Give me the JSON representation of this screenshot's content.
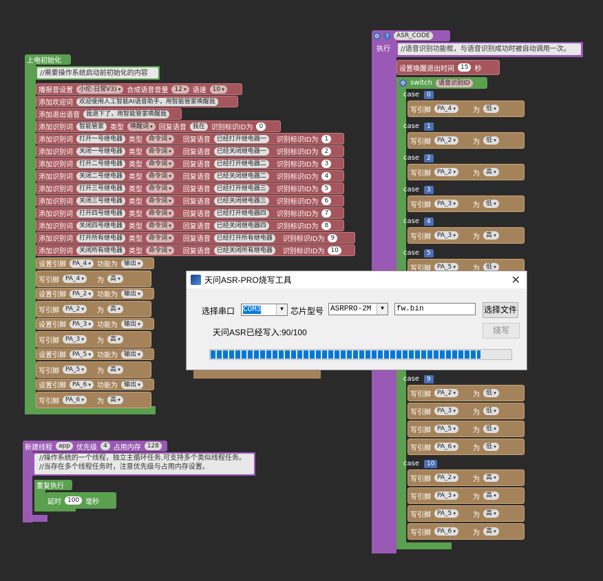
{
  "init": {
    "header": "上电初始化",
    "comment": "//需要操作系统启动前初始化的内容",
    "broadcast": {
      "label": "播报音设置",
      "voice": "小伦-日常V3)",
      "vol_label": "合成语音音量",
      "vol": "12",
      "speed_label": "语速",
      "speed": "10"
    },
    "welcome": {
      "label": "添加欢迎词",
      "text": "欢迎使用人工智能AI语音助手，用智能管家唤醒我"
    },
    "exit": {
      "label": "添加退出语音",
      "text": "我退下了，用智能管家唤醒我"
    },
    "wake": {
      "label": "添加识别词",
      "word": "智能管家",
      "type_label": "类型",
      "type": "唤醒词",
      "reply_label": "回复语音",
      "reply": "我在",
      "id_label": "识别标识ID为",
      "id": "0"
    },
    "cmds": [
      {
        "label": "添加识别词",
        "word": "打开一号继电器",
        "type_label": "类型",
        "type": "命令词",
        "reply_label": "回复语音",
        "reply": "已经打开继电器一",
        "id_label": "识别标识ID为",
        "id": "1"
      },
      {
        "label": "添加识别词",
        "word": "关闭一号继电器",
        "type_label": "类型",
        "type": "命令词",
        "reply_label": "回复语音",
        "reply": "已经关闭继电器一",
        "id_label": "识别标识ID为",
        "id": "2"
      },
      {
        "label": "添加识别词",
        "word": "打开二号继电器",
        "type_label": "类型",
        "type": "命令词",
        "reply_label": "回复语音",
        "reply": "已经打开继电器二",
        "id_label": "识别标识ID为",
        "id": "3"
      },
      {
        "label": "添加识别词",
        "word": "关闭二号继电器",
        "type_label": "类型",
        "type": "命令词",
        "reply_label": "回复语音",
        "reply": "已经关闭继电器二",
        "id_label": "识别标识ID为",
        "id": "4"
      },
      {
        "label": "添加识别词",
        "word": "打开三号继电器",
        "type_label": "类型",
        "type": "命令词",
        "reply_label": "回复语音",
        "reply": "已经打开继电器三",
        "id_label": "识别标识ID为",
        "id": "5"
      },
      {
        "label": "添加识别词",
        "word": "关闭三号继电器",
        "type_label": "类型",
        "type": "命令词",
        "reply_label": "回复语音",
        "reply": "已经关闭继电器三",
        "id_label": "识别标识ID为",
        "id": "6"
      },
      {
        "label": "添加识别词",
        "word": "打开四号继电器",
        "type_label": "类型",
        "type": "命令词",
        "reply_label": "回复语音",
        "reply": "已经打开继电器四",
        "id_label": "识别标识ID为",
        "id": "7"
      },
      {
        "label": "添加识别词",
        "word": "关闭四号继电器",
        "type_label": "类型",
        "type": "命令词",
        "reply_label": "回复语音",
        "reply": "已经关闭继电器四",
        "id_label": "识别标识ID为",
        "id": "8"
      },
      {
        "label": "添加识别词",
        "word": "打开所有继电器",
        "type_label": "类型",
        "type": "命令词",
        "reply_label": "回复语音",
        "reply": "已经打开所有继电器",
        "id_label": "识别标识ID为",
        "id": "9"
      },
      {
        "label": "添加识别词",
        "word": "关闭所有继电器",
        "type_label": "类型",
        "type": "命令词",
        "reply_label": "回复语音",
        "reply": "已经关闭所有继电器",
        "id_label": "识别标识ID为",
        "id": "10"
      }
    ],
    "pins": [
      {
        "set_label": "设置引脚",
        "pin": "PA_4",
        "func_label": "功能为",
        "func": "输出",
        "write_label": "写引脚",
        "as": "为",
        "val": "高"
      },
      {
        "set_label": "设置引脚",
        "pin": "PA_2",
        "func_label": "功能为",
        "func": "输出",
        "write_label": "写引脚",
        "as": "为",
        "val": "高"
      },
      {
        "set_label": "设置引脚",
        "pin": "PA_3",
        "func_label": "功能为",
        "func": "输出",
        "write_label": "写引脚",
        "as": "为",
        "val": "高"
      },
      {
        "set_label": "设置引脚",
        "pin": "PA_5",
        "func_label": "功能为",
        "func": "输出",
        "write_label": "写引脚",
        "as": "为",
        "val": "高"
      },
      {
        "set_label": "设置引脚",
        "pin": "PA_6",
        "func_label": "功能为",
        "func": "输出",
        "write_label": "写引脚",
        "as": "为",
        "val": "高"
      }
    ]
  },
  "thread": {
    "label": "新建线程",
    "name": "app",
    "prio_label": "优先级",
    "prio": "4",
    "mem_label": "占用内存",
    "mem": "128",
    "comment1": "//操作系统的一个线程，独立主循环任务,可支持多个类似线程任务。",
    "comment2": "//当存在多个线程任务时，注意优先级与占用内存设置。",
    "loop": "重复执行",
    "delay_label": "延时",
    "delay": "100",
    "delay_unit": "毫秒"
  },
  "asr": {
    "title": "ASR_CODE",
    "exec": "执行",
    "comment": "//语音识别功能框，与语音识别成功时被自动调用一次。",
    "timeout_label": "设置唤醒退出时间",
    "timeout": "15",
    "timeout_unit": "秒",
    "switch_label": "switch",
    "switch_var": "语音识别ID",
    "case_label": "case",
    "write_label": "写引脚",
    "as": "为",
    "cases": [
      {
        "id": "0",
        "pin": "PA_4",
        "val": "低"
      },
      {
        "id": "1",
        "pin": "PA_2",
        "val": "低"
      },
      {
        "id": "2",
        "pin": "PA_2",
        "val": "高"
      },
      {
        "id": "3",
        "pin": "PA_3",
        "val": "低"
      },
      {
        "id": "4",
        "pin": "PA_3",
        "val": "高"
      },
      {
        "id": "5",
        "pin": "PA_5",
        "val": "低"
      }
    ],
    "case9": {
      "id": "9",
      "rows": [
        {
          "pin": "PA_2",
          "val": "低"
        },
        {
          "pin": "PA_3",
          "val": "低"
        },
        {
          "pin": "PA_5",
          "val": "低"
        },
        {
          "pin": "PA_6",
          "val": "低"
        }
      ]
    },
    "case10": {
      "id": "10",
      "rows": [
        {
          "pin": "PA_2",
          "val": "高"
        },
        {
          "pin": "PA_3",
          "val": "高"
        },
        {
          "pin": "PA_5",
          "val": "高"
        },
        {
          "pin": "PA_6",
          "val": "高"
        }
      ]
    }
  },
  "dialog": {
    "title": "天问ASR-PRO烧写工具",
    "port_label": "选择串口",
    "port": "COM3",
    "chip_label": "芯片型号",
    "chip": "ASRPRO-2M",
    "file": "fw.bin",
    "select_file": "选择文件",
    "status": "天问ASR已经写入:90/100",
    "burn": "烧写",
    "progress": 0.9
  }
}
